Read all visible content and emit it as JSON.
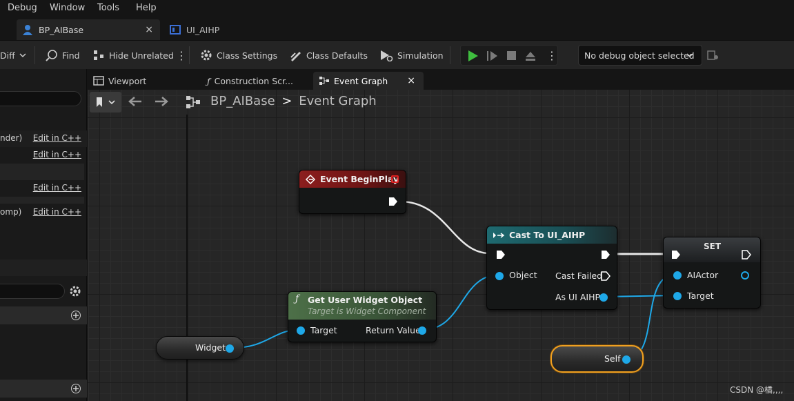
{
  "menu": [
    "Debug",
    "Window",
    "Tools",
    "Help"
  ],
  "doc_tabs": {
    "active": "BP_AIBase",
    "close": "×",
    "other": "UI_AIHP"
  },
  "toolbar": {
    "diff": "Diff",
    "find": "Find",
    "hide_unrelated": "Hide Unrelated",
    "class_settings": "Class Settings",
    "class_defaults": "Class Defaults",
    "simulation": "Simulation",
    "debug_object": "No debug object selected"
  },
  "left_panel": {
    "rows": [
      {
        "label": "nder)",
        "link": "Edit in C++"
      },
      {
        "label": "",
        "link": "Edit in C++"
      },
      {
        "label": "",
        "link": "Edit in C++"
      },
      {
        "label": "omp)",
        "link": "Edit in C++"
      }
    ]
  },
  "graph_tabs": {
    "viewport": "Viewport",
    "construction": "Construction Scr...",
    "event_graph": "Event Graph",
    "close": "×"
  },
  "breadcrumb": {
    "blueprint": "BP_AIBase",
    "separator": ">",
    "graph": "Event Graph"
  },
  "nodes": {
    "begin_play": {
      "title": "Event BeginPlay"
    },
    "cast": {
      "title": "Cast To UI_AIHP",
      "object": "Object",
      "cast_failed": "Cast Failed",
      "as_ui": "As UI AIHP"
    },
    "get_widget": {
      "title": "Get User Widget Object",
      "subtitle": "Target is Widget Component",
      "target": "Target",
      "return_value": "Return Value"
    },
    "set": {
      "title": "SET",
      "aiactor": "AIActor",
      "target": "Target"
    },
    "widget_var": {
      "label": "Widget"
    },
    "self_var": {
      "label": "Self"
    }
  },
  "watermark": "CSDN @橘,,,,",
  "colors": {
    "exec": "#ffffff",
    "object_pin": "#1ea8e8",
    "event_header": "#8a1d1d",
    "cast_header": "#1e5e63",
    "func_header": "#4a6b47",
    "select": "#f0a020"
  }
}
